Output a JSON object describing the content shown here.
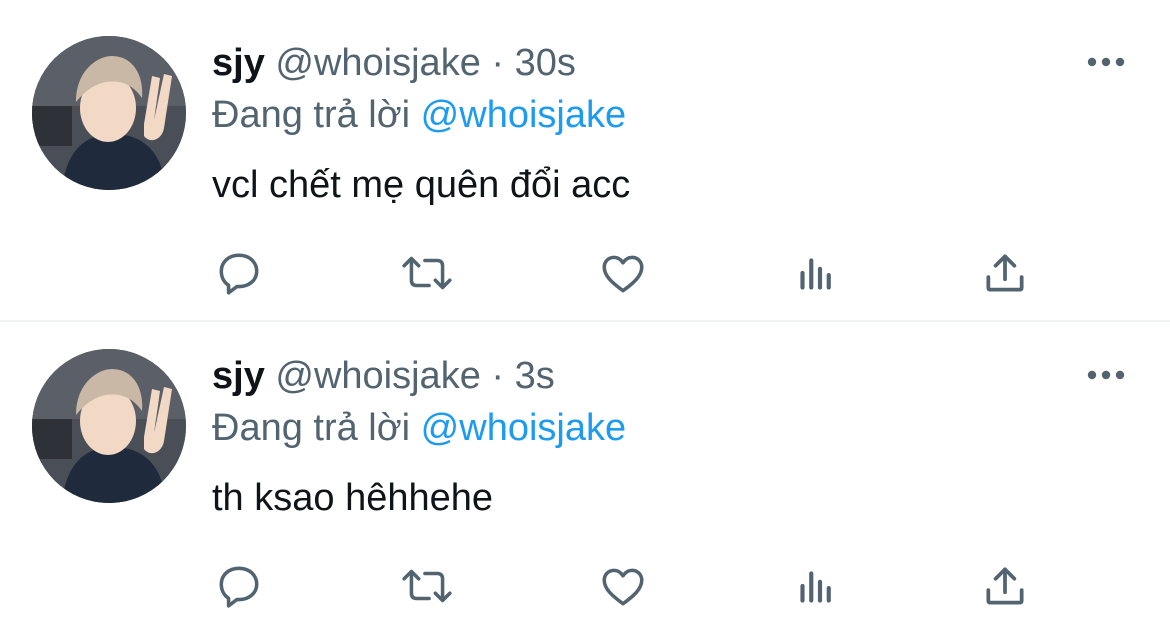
{
  "tweets": [
    {
      "display_name": "sjy",
      "handle": "@whoisjake",
      "separator": "·",
      "time": "30s",
      "replying_prefix": "Đang trả lời",
      "replying_to": "@whoisjake",
      "text": "vcl chết mẹ quên đổi acc",
      "avatar_icon": "profile-photo",
      "actions": [
        "reply-icon",
        "retweet-icon",
        "like-icon",
        "views-icon",
        "share-icon"
      ],
      "more_icon": "more-options-icon"
    },
    {
      "display_name": "sjy",
      "handle": "@whoisjake",
      "separator": "·",
      "time": "3s",
      "replying_prefix": "Đang trả lời",
      "replying_to": "@whoisjake",
      "text": "th ksao hêhhehe",
      "avatar_icon": "profile-photo",
      "actions": [
        "reply-icon",
        "retweet-icon",
        "like-icon",
        "views-icon",
        "share-icon"
      ],
      "more_icon": "more-options-icon"
    }
  ],
  "colors": {
    "text_primary": "#0f1419",
    "text_secondary": "#536471",
    "accent": "#1d9bf0",
    "icon": "#536471",
    "divider": "#eff3f4"
  }
}
